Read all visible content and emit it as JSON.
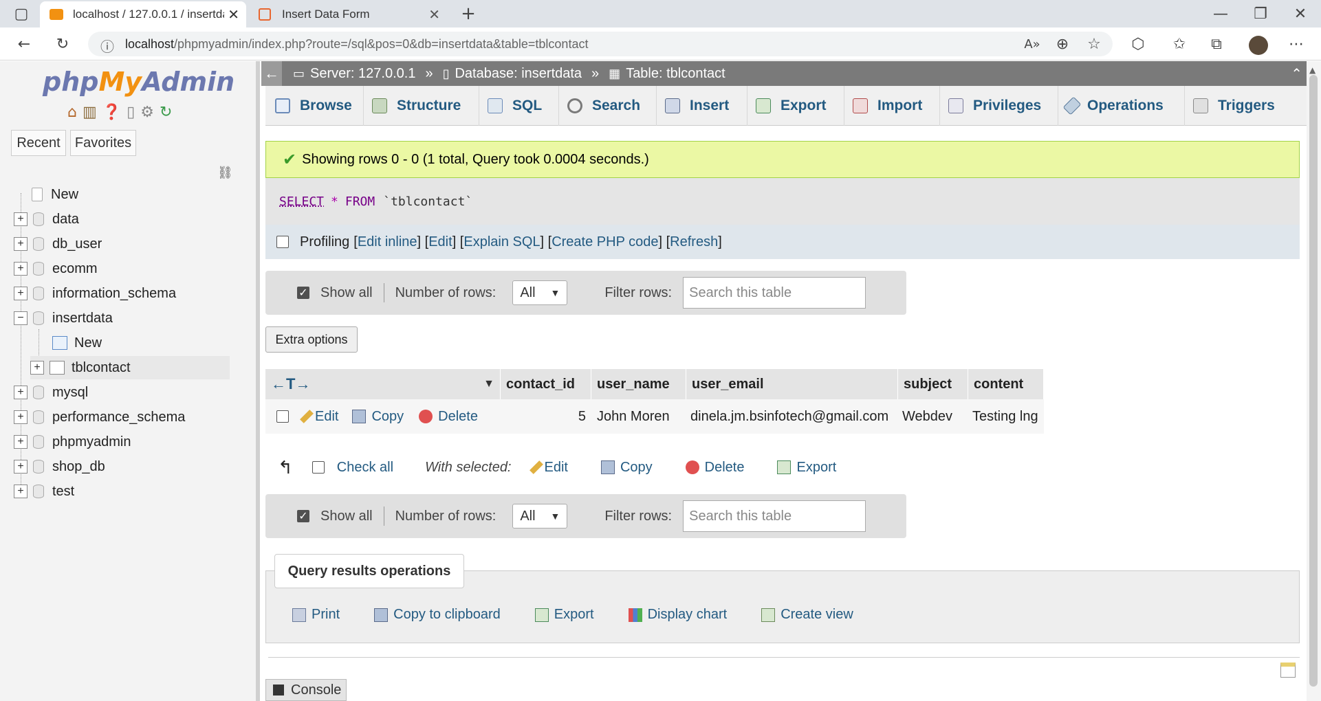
{
  "browser": {
    "tabs": [
      {
        "title": "localhost / 127.0.0.1 / insertdata",
        "active": true
      },
      {
        "title": "Insert Data Form",
        "active": false
      }
    ],
    "url_host": "localhost",
    "url_path": "/phpmyadmin/index.php?route=/sql&pos=0&db=insertdata&table=tblcontact"
  },
  "sidebar": {
    "logo": {
      "php": "php",
      "my": "My",
      "admin": "Admin"
    },
    "tabs": [
      "Recent",
      "Favorites"
    ],
    "tree": [
      {
        "label": "New",
        "type": "new"
      },
      {
        "label": "data",
        "type": "db"
      },
      {
        "label": "db_user",
        "type": "db"
      },
      {
        "label": "ecomm",
        "type": "db"
      },
      {
        "label": "information_schema",
        "type": "db"
      },
      {
        "label": "insertdata",
        "type": "db",
        "expanded": true
      },
      {
        "label": "New",
        "type": "sub-new"
      },
      {
        "label": "tblcontact",
        "type": "table"
      },
      {
        "label": "mysql",
        "type": "db"
      },
      {
        "label": "performance_schema",
        "type": "db"
      },
      {
        "label": "phpmyadmin",
        "type": "db"
      },
      {
        "label": "shop_db",
        "type": "db"
      },
      {
        "label": "test",
        "type": "db"
      }
    ]
  },
  "breadcrumb": {
    "server": "Server: 127.0.0.1",
    "database": "Database: insertdata",
    "table": "Table: tblcontact",
    "sep": "»"
  },
  "menu": [
    "Browse",
    "Structure",
    "SQL",
    "Search",
    "Insert",
    "Export",
    "Import",
    "Privileges",
    "Operations",
    "Triggers"
  ],
  "result": {
    "message": "Showing rows 0 - 0 (1 total, Query took 0.0004 seconds.)",
    "sql_select": "SELECT",
    "sql_star": "*",
    "sql_from": "FROM",
    "sql_table": "`tblcontact`"
  },
  "profiling": {
    "label": "Profiling",
    "links": [
      "Edit inline",
      "Edit",
      "Explain SQL",
      "Create PHP code",
      "Refresh"
    ]
  },
  "nav": {
    "show_all": "Show all",
    "rows_label": "Number of rows:",
    "rows_value": "All",
    "filter_label": "Filter rows:",
    "filter_placeholder": "Search this table"
  },
  "extra_options": "Extra options",
  "table": {
    "arrows": "←T→",
    "columns": [
      "contact_id",
      "user_name",
      "user_email",
      "subject",
      "content"
    ],
    "row_actions": [
      "Edit",
      "Copy",
      "Delete"
    ],
    "rows": [
      {
        "contact_id": "5",
        "user_name": "John Moren",
        "user_email": "dinela.jm.bsinfotech@gmail.com",
        "subject": "Webdev",
        "content": "Testing lng"
      }
    ]
  },
  "bulk": {
    "check_all": "Check all",
    "with_selected": "With selected:",
    "actions": [
      "Edit",
      "Copy",
      "Delete",
      "Export"
    ]
  },
  "query_ops": {
    "title": "Query results operations",
    "items": [
      "Print",
      "Copy to clipboard",
      "Export",
      "Display chart",
      "Create view"
    ]
  },
  "console": "Console",
  "colors": {
    "link": "#235a81",
    "success_bg": "#ebf8a4",
    "topbar": "#7a7a7a"
  }
}
